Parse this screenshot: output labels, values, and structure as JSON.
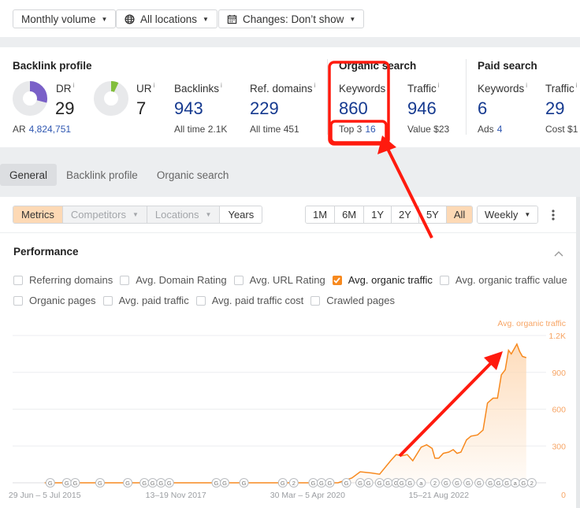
{
  "toolbar": {
    "volume_label": "Monthly volume",
    "location_label": "All locations",
    "changes_label": "Changes: Don’t show",
    "icons": {
      "location": "globe-icon",
      "changes": "calendar-icon",
      "dropdown": "caret-down-icon"
    }
  },
  "backlink_profile": {
    "title": "Backlink profile",
    "dr": {
      "label": "DR",
      "value": "29",
      "percent": 29,
      "color": "#7a60c8"
    },
    "ur": {
      "label": "UR",
      "value": "7",
      "percent": 7,
      "color": "#82be3c"
    },
    "ar": {
      "label": "AR",
      "value": "4,824,751"
    },
    "backlinks": {
      "label": "Backlinks",
      "value": "943",
      "sub_label": "All time",
      "sub_value": "2.1K"
    },
    "ref_domains": {
      "label": "Ref. domains",
      "value": "229",
      "sub_label": "All time",
      "sub_value": "451"
    }
  },
  "organic_search": {
    "title": "Organic search",
    "keywords": {
      "label": "Keywords",
      "value": "860",
      "sub_label": "Top 3",
      "sub_value": "16"
    },
    "traffic": {
      "label": "Traffic",
      "value": "946",
      "sub_label": "Value",
      "sub_value": "$23"
    }
  },
  "paid_search": {
    "title": "Paid search",
    "keywords": {
      "label": "Keywords",
      "value": "6",
      "sub_label": "Ads",
      "sub_value": "4"
    },
    "traffic": {
      "label": "Traffic",
      "value": "29",
      "sub_label": "Cost",
      "sub_value": "$1"
    }
  },
  "info_marker": "i",
  "tabs": [
    {
      "label": "General",
      "active": true
    },
    {
      "label": "Backlink profile",
      "active": false
    },
    {
      "label": "Organic search",
      "active": false
    }
  ],
  "view_segments": [
    {
      "label": "Metrics",
      "state": "on"
    },
    {
      "label": "Competitors",
      "state": "disabled",
      "dropdown": true
    },
    {
      "label": "Locations",
      "state": "disabled",
      "dropdown": true
    },
    {
      "label": "Years",
      "state": "normal"
    }
  ],
  "ranges": [
    {
      "label": "1M",
      "active": false
    },
    {
      "label": "6M",
      "active": false
    },
    {
      "label": "1Y",
      "active": false
    },
    {
      "label": "2Y",
      "active": false
    },
    {
      "label": "5Y",
      "active": false
    },
    {
      "label": "All",
      "active": true
    }
  ],
  "interval": {
    "label": "Weekly"
  },
  "performance": {
    "title": "Performance",
    "checkboxes_row1": [
      {
        "label": "Referring domains",
        "checked": false
      },
      {
        "label": "Avg. Domain Rating",
        "checked": false
      },
      {
        "label": "Avg. URL Rating",
        "checked": false
      },
      {
        "label": "Avg. organic traffic",
        "checked": true
      },
      {
        "label": "Avg. organic traffic value",
        "checked": false
      }
    ],
    "checkboxes_row2": [
      {
        "label": "Organic pages",
        "checked": false
      },
      {
        "label": "Avg. paid traffic",
        "checked": false
      },
      {
        "label": "Avg. paid traffic cost",
        "checked": false
      },
      {
        "label": "Crawled pages",
        "checked": false
      }
    ]
  },
  "chart_data": {
    "type": "area",
    "title": "",
    "series": [
      {
        "name": "Avg. organic traffic",
        "color": "#f7891e",
        "x": [
          2015.5,
          2016.0,
          2017.0,
          2018.0,
          2019.0,
          2020.0,
          2020.8,
          2021.05,
          2021.2,
          2021.4,
          2021.55,
          2021.75,
          2021.85,
          2021.95,
          2022.05,
          2022.15,
          2022.3,
          2022.4,
          2022.5,
          2022.55,
          2022.62,
          2022.7,
          2022.8,
          2022.88,
          2022.95,
          2023.02,
          2023.12,
          2023.2,
          2023.32,
          2023.42,
          2023.5,
          2023.6,
          2023.68,
          2023.75,
          2023.82,
          2023.88,
          2023.93,
          2023.98,
          2024.03,
          2024.08,
          2024.13,
          2024.2
        ],
        "values": [
          0,
          0,
          0,
          0,
          0,
          0,
          0,
          40,
          90,
          80,
          70,
          180,
          230,
          220,
          230,
          180,
          290,
          310,
          280,
          200,
          200,
          240,
          250,
          270,
          240,
          250,
          350,
          380,
          390,
          430,
          650,
          690,
          690,
          880,
          920,
          1080,
          1050,
          1090,
          1130,
          1070,
          1030,
          1020
        ]
      }
    ],
    "x_tick_labels": [
      "29 Jun – 5 Jul 2015",
      "13–19 Nov 2017",
      "30 Mar – 5 Apr 2020",
      "15–21 Aug 2022"
    ],
    "x_ticks": [
      2015.5,
      2017.87,
      2020.25,
      2022.62
    ],
    "y_ticks": [
      0,
      300,
      600,
      900,
      1200
    ],
    "y_tick_labels": [
      "0",
      "300",
      "600",
      "900",
      "1.2K"
    ],
    "ylabel": "Avg. organic traffic",
    "ylim": [
      0,
      1200
    ],
    "xlim": [
      2014.92,
      2025.0
    ],
    "grid": true,
    "legend": "top-right",
    "annotation_markers": [
      {
        "x": 2015.6,
        "label": "G"
      },
      {
        "x": 2015.9,
        "label": "G"
      },
      {
        "x": 2016.05,
        "label": "G"
      },
      {
        "x": 2016.5,
        "label": "G"
      },
      {
        "x": 2017.0,
        "label": "G"
      },
      {
        "x": 2017.3,
        "label": "G"
      },
      {
        "x": 2017.45,
        "label": "G"
      },
      {
        "x": 2017.6,
        "label": "G"
      },
      {
        "x": 2017.75,
        "label": "G"
      },
      {
        "x": 2018.6,
        "label": "G"
      },
      {
        "x": 2018.75,
        "label": "G"
      },
      {
        "x": 2019.1,
        "label": "G"
      },
      {
        "x": 2019.8,
        "label": "G"
      },
      {
        "x": 2020.0,
        "label": "2"
      },
      {
        "x": 2020.35,
        "label": "G"
      },
      {
        "x": 2020.5,
        "label": "G"
      },
      {
        "x": 2020.65,
        "label": "G"
      },
      {
        "x": 2020.95,
        "label": "G"
      },
      {
        "x": 2021.2,
        "label": "G"
      },
      {
        "x": 2021.35,
        "label": "G"
      },
      {
        "x": 2021.55,
        "label": "G"
      },
      {
        "x": 2021.7,
        "label": "G"
      },
      {
        "x": 2021.85,
        "label": "G"
      },
      {
        "x": 2021.95,
        "label": "G"
      },
      {
        "x": 2022.1,
        "label": "G"
      },
      {
        "x": 2022.3,
        "label": "a"
      },
      {
        "x": 2022.55,
        "label": "2"
      },
      {
        "x": 2022.75,
        "label": "G"
      },
      {
        "x": 2022.95,
        "label": "G"
      },
      {
        "x": 2023.15,
        "label": "G"
      },
      {
        "x": 2023.35,
        "label": "G"
      },
      {
        "x": 2023.55,
        "label": "G"
      },
      {
        "x": 2023.7,
        "label": "G"
      },
      {
        "x": 2023.85,
        "label": "G"
      },
      {
        "x": 2024.0,
        "label": "a"
      },
      {
        "x": 2024.15,
        "label": "G"
      },
      {
        "x": 2024.3,
        "label": "2"
      }
    ]
  },
  "annotations": {
    "highlight_color": "#ff1a0e",
    "highlight_boxes": [
      "organic-keywords",
      "organic-top3"
    ],
    "arrows": [
      "arrow-to-top3",
      "arrow-to-traffic-peak"
    ]
  }
}
